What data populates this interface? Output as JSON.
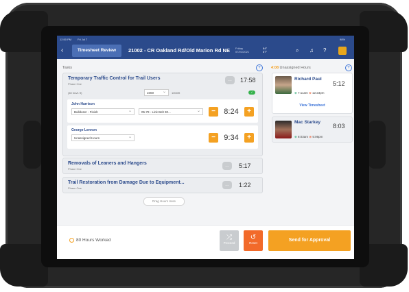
{
  "status_bar": {
    "time": "12:50 PM",
    "date": "Fri Jul 7",
    "battery": "98%"
  },
  "header": {
    "back_icon": "chevron-left-icon",
    "active_tab": "Timesheet Review",
    "job_title": "21002 - CR Oakland Rd/Old Marion Rd NE",
    "day": "Friday",
    "date": "07/01/2021",
    "temperature": "84°",
    "temp_low": "67°",
    "icons": [
      "search-icon",
      "bell-icon",
      "help-icon"
    ]
  },
  "tasks_section": {
    "label": "Tasks",
    "tasks": [
      {
        "title": "Temporary Traffic Control for Trail Users",
        "phase": "Phase One",
        "time": "17:58",
        "quantity_label": "(40 hrs/1 ft)",
        "quantity_value": "1000",
        "quantity_unit": "1000/ft",
        "badge": "✓",
        "assignments": [
          {
            "name": "John Harrison",
            "equipment": "Bulldozer - Finish",
            "cost_code": "05-79 - Link Belt 30...",
            "hours": "8:24"
          },
          {
            "name": "George Lennon",
            "equipment": "Unassigned Hours",
            "cost_code": "",
            "hours": "9:34"
          }
        ]
      },
      {
        "title": "Removals of Leaners and Hangers",
        "phase": "Phase One",
        "time": "5:17"
      },
      {
        "title": "Trail Restoration from Damage Due to Equipment...",
        "phase": "Phase One",
        "time": "1:22"
      }
    ],
    "drag_hint": "Drag Hours Here"
  },
  "unassigned": {
    "label_count": "4:08",
    "label_text": "Unassigned Hours",
    "workers": [
      {
        "name": "Richard Paul",
        "total": "5:12",
        "in": "7:11am",
        "out": "12:23pm",
        "link": "View Timesheet"
      },
      {
        "name": "Mac Starkey",
        "total": "8:03",
        "in": "8:03am",
        "out": "5:06pm"
      }
    ]
  },
  "footer": {
    "hours_worked": "80 Hours Worked",
    "proceed_label": "Proceed",
    "reset_label": "Reset",
    "send_label": "Send for Approval"
  },
  "colors": {
    "primary": "#2b4a8b",
    "accent": "#f4a122",
    "reset": "#f26a2a"
  }
}
